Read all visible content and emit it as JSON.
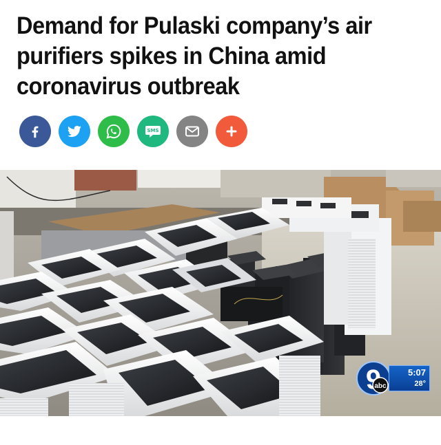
{
  "article": {
    "headline": "Demand for Pulaski company’s air purifiers spikes in China amid coronavirus outbreak"
  },
  "share": {
    "buttons": [
      {
        "id": "facebook",
        "icon": "facebook-icon",
        "color": "#3b5998"
      },
      {
        "id": "twitter",
        "icon": "twitter-bird-icon",
        "color": "#1da1f2"
      },
      {
        "id": "whatsapp",
        "icon": "whatsapp-icon",
        "color": "#2fbd4a"
      },
      {
        "id": "sms",
        "icon": "sms-bubble-icon",
        "label": "SMS",
        "color": "#1fb87f"
      },
      {
        "id": "email",
        "icon": "envelope-icon",
        "color": "#848484"
      },
      {
        "id": "more",
        "icon": "plus-icon",
        "color": "#f15a3a"
      }
    ]
  },
  "photo": {
    "station_logo": "9 abc",
    "bug_time": "5:07",
    "bug_temperature": "28°"
  }
}
